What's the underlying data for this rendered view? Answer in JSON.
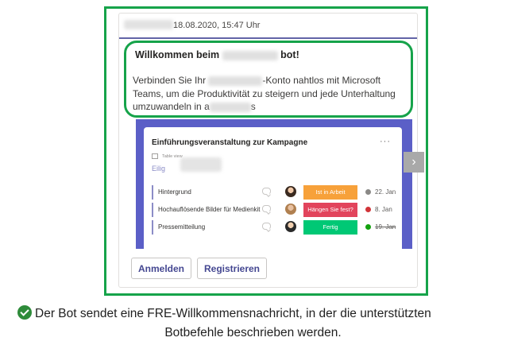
{
  "message": {
    "timestamp": "18.08.2020, 15:47 Uhr",
    "welcome_prefix": "Willkommen beim",
    "welcome_suffix": "bot!",
    "para_1": "Verbinden Sie Ihr",
    "para_2": "-Konto nahtlos mit Microsoft Teams, um die Produktivität zu steigern und jede Unterhaltung umzuwandeln in",
    "para_3": "a",
    "para_4": "s"
  },
  "preview": {
    "title": "Einführungsveranstaltung zur Kampagne",
    "menu": "···",
    "view_label": "Table view",
    "group_label": "Eilig",
    "tasks": [
      {
        "name": "Hintergrund",
        "status": "Ist in Arbeit",
        "status_color": "#f7a13a",
        "date": "22. Jan",
        "date_icon_color": "#8a8886"
      },
      {
        "name": "Hochauflösende Bilder für Medienkit",
        "status": "Hängen Sie fest?",
        "status_color": "#e2445c",
        "date": "8. Jan",
        "date_icon_color": "#d13438"
      },
      {
        "name": "Pressemitteilung",
        "status": "Fertig",
        "status_color": "#00c875",
        "date": "19. Jan",
        "date_icon_color": "#13a10e"
      }
    ]
  },
  "actions": {
    "login": "Anmelden",
    "register": "Registrieren"
  },
  "caption": {
    "line1": "Der Bot sendet eine FRE-Willkommensnachricht, in der die unterstützten",
    "line2": "Botbefehle beschrieben werden."
  },
  "colors": {
    "highlight": "#16a34a",
    "accent": "#6264a7"
  }
}
